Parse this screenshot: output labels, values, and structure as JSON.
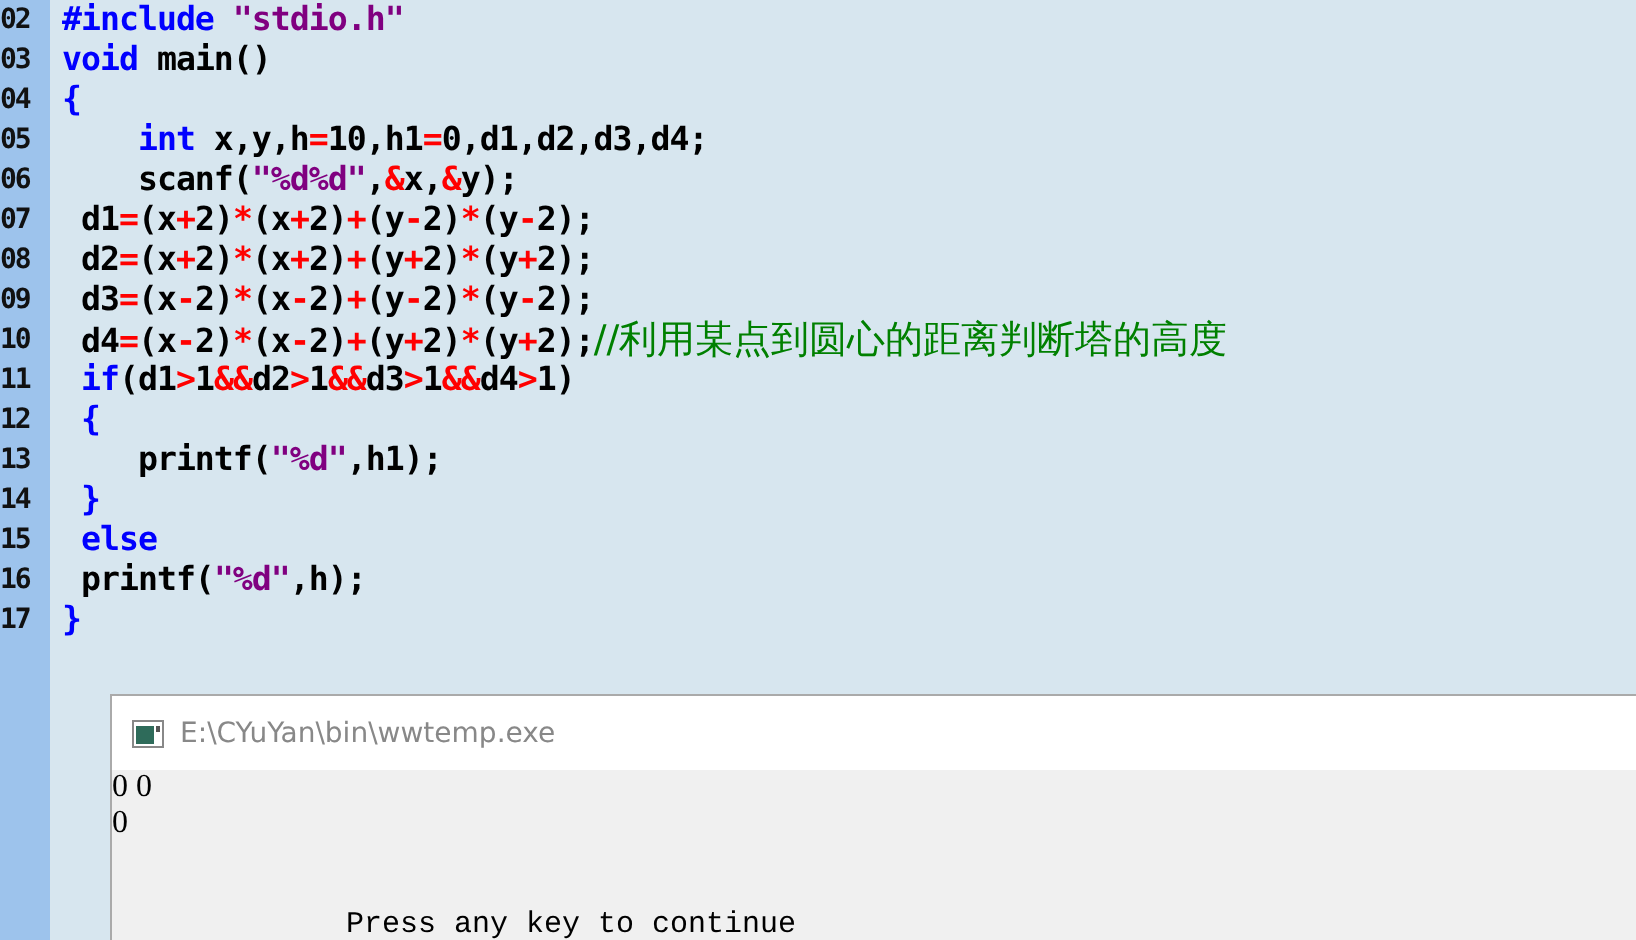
{
  "editor": {
    "lines": [
      {
        "number": "02",
        "tokens": [
          {
            "kind": "keyword",
            "text": "#include "
          },
          {
            "kind": "string",
            "text": "\"stdio.h\""
          }
        ]
      },
      {
        "number": "03",
        "tokens": [
          {
            "kind": "keyword",
            "text": "void"
          },
          {
            "kind": "plain",
            "text": " main()"
          }
        ]
      },
      {
        "number": "04",
        "tokens": [
          {
            "kind": "keyword",
            "text": "{"
          }
        ]
      },
      {
        "number": "05",
        "tokens": [
          {
            "kind": "keyword",
            "text": "    int"
          },
          {
            "kind": "plain",
            "text": " x,y,h"
          },
          {
            "kind": "operator",
            "text": "="
          },
          {
            "kind": "plain",
            "text": "10,h1"
          },
          {
            "kind": "operator",
            "text": "="
          },
          {
            "kind": "plain",
            "text": "0,d1,d2,d3,d4;"
          }
        ]
      },
      {
        "number": "06",
        "tokens": [
          {
            "kind": "plain",
            "text": "    scanf("
          },
          {
            "kind": "string",
            "text": "\"%d%d\""
          },
          {
            "kind": "plain",
            "text": ","
          },
          {
            "kind": "operator",
            "text": "&"
          },
          {
            "kind": "plain",
            "text": "x,"
          },
          {
            "kind": "operator",
            "text": "&"
          },
          {
            "kind": "plain",
            "text": "y);"
          }
        ]
      },
      {
        "number": "07",
        "tokens": [
          {
            "kind": "plain",
            "text": " d1"
          },
          {
            "kind": "operator",
            "text": "="
          },
          {
            "kind": "plain",
            "text": "(x"
          },
          {
            "kind": "operator",
            "text": "+"
          },
          {
            "kind": "plain",
            "text": "2)"
          },
          {
            "kind": "operator",
            "text": "*"
          },
          {
            "kind": "plain",
            "text": "(x"
          },
          {
            "kind": "operator",
            "text": "+"
          },
          {
            "kind": "plain",
            "text": "2)"
          },
          {
            "kind": "operator",
            "text": "+"
          },
          {
            "kind": "plain",
            "text": "(y"
          },
          {
            "kind": "operator",
            "text": "-"
          },
          {
            "kind": "plain",
            "text": "2)"
          },
          {
            "kind": "operator",
            "text": "*"
          },
          {
            "kind": "plain",
            "text": "(y"
          },
          {
            "kind": "operator",
            "text": "-"
          },
          {
            "kind": "plain",
            "text": "2);"
          }
        ]
      },
      {
        "number": "08",
        "tokens": [
          {
            "kind": "plain",
            "text": " d2"
          },
          {
            "kind": "operator",
            "text": "="
          },
          {
            "kind": "plain",
            "text": "(x"
          },
          {
            "kind": "operator",
            "text": "+"
          },
          {
            "kind": "plain",
            "text": "2)"
          },
          {
            "kind": "operator",
            "text": "*"
          },
          {
            "kind": "plain",
            "text": "(x"
          },
          {
            "kind": "operator",
            "text": "+"
          },
          {
            "kind": "plain",
            "text": "2)"
          },
          {
            "kind": "operator",
            "text": "+"
          },
          {
            "kind": "plain",
            "text": "(y"
          },
          {
            "kind": "operator",
            "text": "+"
          },
          {
            "kind": "plain",
            "text": "2)"
          },
          {
            "kind": "operator",
            "text": "*"
          },
          {
            "kind": "plain",
            "text": "(y"
          },
          {
            "kind": "operator",
            "text": "+"
          },
          {
            "kind": "plain",
            "text": "2);"
          }
        ]
      },
      {
        "number": "09",
        "tokens": [
          {
            "kind": "plain",
            "text": " d3"
          },
          {
            "kind": "operator",
            "text": "="
          },
          {
            "kind": "plain",
            "text": "(x"
          },
          {
            "kind": "operator",
            "text": "-"
          },
          {
            "kind": "plain",
            "text": "2)"
          },
          {
            "kind": "operator",
            "text": "*"
          },
          {
            "kind": "plain",
            "text": "(x"
          },
          {
            "kind": "operator",
            "text": "-"
          },
          {
            "kind": "plain",
            "text": "2)"
          },
          {
            "kind": "operator",
            "text": "+"
          },
          {
            "kind": "plain",
            "text": "(y"
          },
          {
            "kind": "operator",
            "text": "-"
          },
          {
            "kind": "plain",
            "text": "2)"
          },
          {
            "kind": "operator",
            "text": "*"
          },
          {
            "kind": "plain",
            "text": "(y"
          },
          {
            "kind": "operator",
            "text": "-"
          },
          {
            "kind": "plain",
            "text": "2);"
          }
        ]
      },
      {
        "number": "10",
        "tokens": [
          {
            "kind": "plain",
            "text": " d4"
          },
          {
            "kind": "operator",
            "text": "="
          },
          {
            "kind": "plain",
            "text": "(x"
          },
          {
            "kind": "operator",
            "text": "-"
          },
          {
            "kind": "plain",
            "text": "2)"
          },
          {
            "kind": "operator",
            "text": "*"
          },
          {
            "kind": "plain",
            "text": "(x"
          },
          {
            "kind": "operator",
            "text": "-"
          },
          {
            "kind": "plain",
            "text": "2)"
          },
          {
            "kind": "operator",
            "text": "+"
          },
          {
            "kind": "plain",
            "text": "(y"
          },
          {
            "kind": "operator",
            "text": "+"
          },
          {
            "kind": "plain",
            "text": "2)"
          },
          {
            "kind": "operator",
            "text": "*"
          },
          {
            "kind": "plain",
            "text": "(y"
          },
          {
            "kind": "operator",
            "text": "+"
          },
          {
            "kind": "plain",
            "text": "2);"
          },
          {
            "kind": "comment",
            "text": "//利用某点到圆心的距离判断塔的高度"
          }
        ]
      },
      {
        "number": "11",
        "tokens": [
          {
            "kind": "keyword",
            "text": " if"
          },
          {
            "kind": "plain",
            "text": "(d1"
          },
          {
            "kind": "operator",
            "text": ">"
          },
          {
            "kind": "plain",
            "text": "1"
          },
          {
            "kind": "operator",
            "text": "&&"
          },
          {
            "kind": "plain",
            "text": "d2"
          },
          {
            "kind": "operator",
            "text": ">"
          },
          {
            "kind": "plain",
            "text": "1"
          },
          {
            "kind": "operator",
            "text": "&&"
          },
          {
            "kind": "plain",
            "text": "d3"
          },
          {
            "kind": "operator",
            "text": ">"
          },
          {
            "kind": "plain",
            "text": "1"
          },
          {
            "kind": "operator",
            "text": "&&"
          },
          {
            "kind": "plain",
            "text": "d4"
          },
          {
            "kind": "operator",
            "text": ">"
          },
          {
            "kind": "plain",
            "text": "1)"
          }
        ]
      },
      {
        "number": "12",
        "tokens": [
          {
            "kind": "keyword",
            "text": " {"
          }
        ]
      },
      {
        "number": "13",
        "tokens": [
          {
            "kind": "plain",
            "text": "    printf("
          },
          {
            "kind": "string",
            "text": "\"%d\""
          },
          {
            "kind": "plain",
            "text": ",h1);"
          }
        ]
      },
      {
        "number": "14",
        "tokens": [
          {
            "kind": "keyword",
            "text": " }"
          }
        ]
      },
      {
        "number": "15",
        "tokens": [
          {
            "kind": "keyword",
            "text": " else"
          }
        ]
      },
      {
        "number": "16",
        "tokens": [
          {
            "kind": "plain",
            "text": " printf("
          },
          {
            "kind": "string",
            "text": "\"%d\""
          },
          {
            "kind": "plain",
            "text": ",h);"
          }
        ]
      },
      {
        "number": "17",
        "tokens": [
          {
            "kind": "keyword",
            "text": "}"
          }
        ]
      }
    ]
  },
  "console": {
    "title": "E:\\CYuYan\\bin\\wwtemp.exe",
    "output": [
      "0 0",
      "0"
    ],
    "prompt": "Press any key to continue"
  }
}
